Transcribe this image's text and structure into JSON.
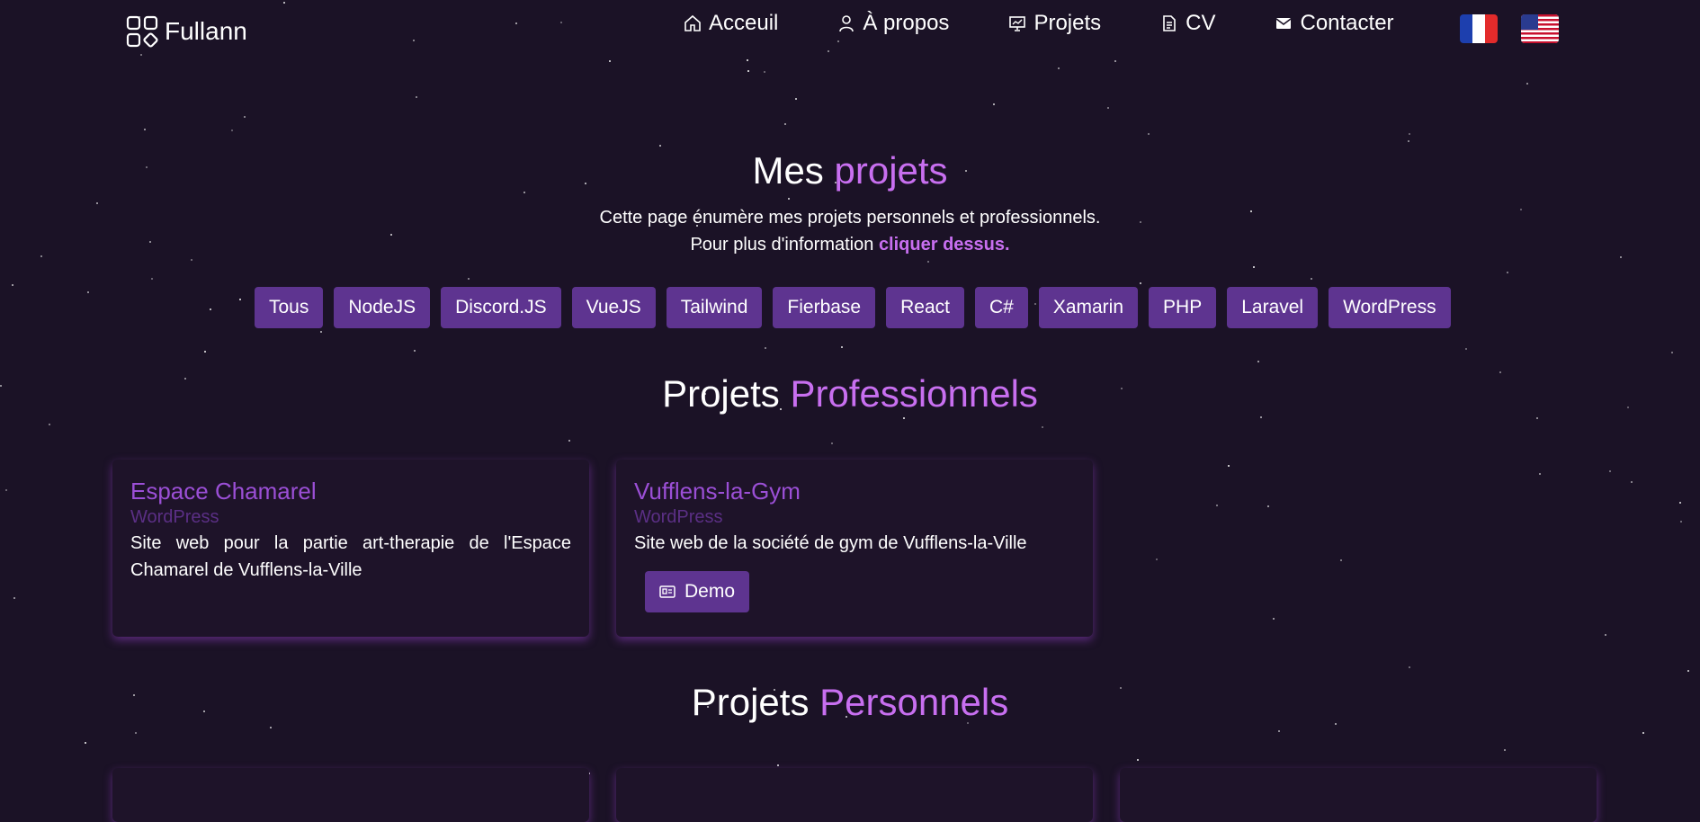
{
  "brand": {
    "name": "Fullann"
  },
  "nav": [
    {
      "label": "Acceuil",
      "icon": "home-icon"
    },
    {
      "label": "À propos",
      "icon": "user-icon"
    },
    {
      "label": "Projets",
      "icon": "presentation-icon"
    },
    {
      "label": "CV",
      "icon": "document-icon"
    },
    {
      "label": "Contacter",
      "icon": "mail-icon"
    }
  ],
  "languages": [
    "fr-flag-icon",
    "us-flag-icon"
  ],
  "hero": {
    "title_prefix": "Mes",
    "title_accent": "projets",
    "line1": "Cette page énumère mes projets personnels et professionnels.",
    "line2_prefix": "Pour plus d'information",
    "line2_link": "cliquer dessus."
  },
  "filters": [
    "Tous",
    "NodeJS",
    "Discord.JS",
    "VueJS",
    "Tailwind",
    "Fierbase",
    "React",
    "C#",
    "Xamarin",
    "PHP",
    "Laravel",
    "WordPress"
  ],
  "sections": {
    "professional": {
      "prefix": "Projets",
      "accent": "Professionnels"
    },
    "personal": {
      "prefix": "Projets",
      "accent": "Personnels"
    }
  },
  "projects": [
    {
      "title": "Espace Chamarel",
      "tech": "WordPress",
      "description": "Site web pour la partie art-therapie de l'Espace Chamarel de Vufflens-la-Ville"
    },
    {
      "title": "Vufflens-la-Gym",
      "tech": "WordPress",
      "description": "Site web de la société de gym de Vufflens-la-Ville",
      "button": "Demo"
    }
  ],
  "colors": {
    "background": "#1b1226",
    "accent": "#c86ff0",
    "button": "#5e3490",
    "card_title": "#9b4fd6"
  }
}
